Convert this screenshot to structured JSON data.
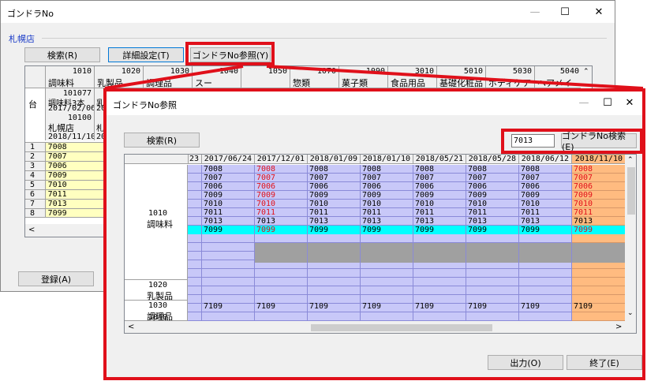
{
  "main": {
    "title": "ゴンドラNo",
    "store": "札幌店",
    "buttons": {
      "search": "検索(R)",
      "detail": "詳細設定(T)",
      "gondola_ref": "ゴンドラNo参照(Y)",
      "register": "登録(A)"
    },
    "header_codes": [
      "1010",
      "1020",
      "1030",
      "1040",
      "1050",
      "1070",
      "1090",
      "3010",
      "5010",
      "5030",
      "5040"
    ],
    "header_names": [
      "調味料",
      "乳製品",
      "調理品",
      "スー",
      "",
      "惣類",
      "菓子類",
      "食品用品",
      "基礎化粧品",
      "ボディケア",
      "ヘアメイ"
    ],
    "corner": "台",
    "meta": {
      "code": "101077",
      "name": "調味料3本",
      "date": "2017/02/06",
      "store_code": "10100",
      "store_name": "札幌店",
      "last_date": "2018/11/10",
      "partial1": "乳",
      "partial2": "20",
      "partial3": "札",
      "partial4": "20"
    },
    "rows": [
      {
        "n": "1",
        "v": "7008"
      },
      {
        "n": "2",
        "v": "7007"
      },
      {
        "n": "3",
        "v": "7006"
      },
      {
        "n": "4",
        "v": "7009"
      },
      {
        "n": "5",
        "v": "7010"
      },
      {
        "n": "6",
        "v": "7011"
      },
      {
        "n": "7",
        "v": "7013"
      },
      {
        "n": "8",
        "v": "7099"
      }
    ]
  },
  "ref": {
    "title": "ゴンドラNo参照",
    "search_label": "検索(R)",
    "input_value": "7013",
    "gondola_search_label": "ゴンドラNo検索(E)",
    "output_label": "出力(O)",
    "close_label": "終了(E)",
    "dates": [
      "23",
      "2017/06/24",
      "2017/12/01",
      "2018/01/09",
      "2018/01/10",
      "2018/05/21",
      "2018/05/28",
      "2018/06/12",
      "2018/11/10"
    ],
    "sections": [
      {
        "code": "1010",
        "name": "調味料"
      },
      {
        "code": "1020",
        "name": "乳製品"
      },
      {
        "code": "1030",
        "name": "調理品"
      },
      {
        "code": "1040",
        "name": ""
      }
    ],
    "values_1010": [
      "7008",
      "7007",
      "7006",
      "7009",
      "7010",
      "7011",
      "7013",
      "7099"
    ],
    "value_1030": "7109",
    "highlight_value": "7013",
    "colors": {
      "lavender": "#c8c8f8",
      "red_text": "#e0101a",
      "cyan": "#00ffff",
      "orange": "#ffbb80",
      "gray_block": "#a0a0a0",
      "yellow": "#ffffc0"
    }
  }
}
